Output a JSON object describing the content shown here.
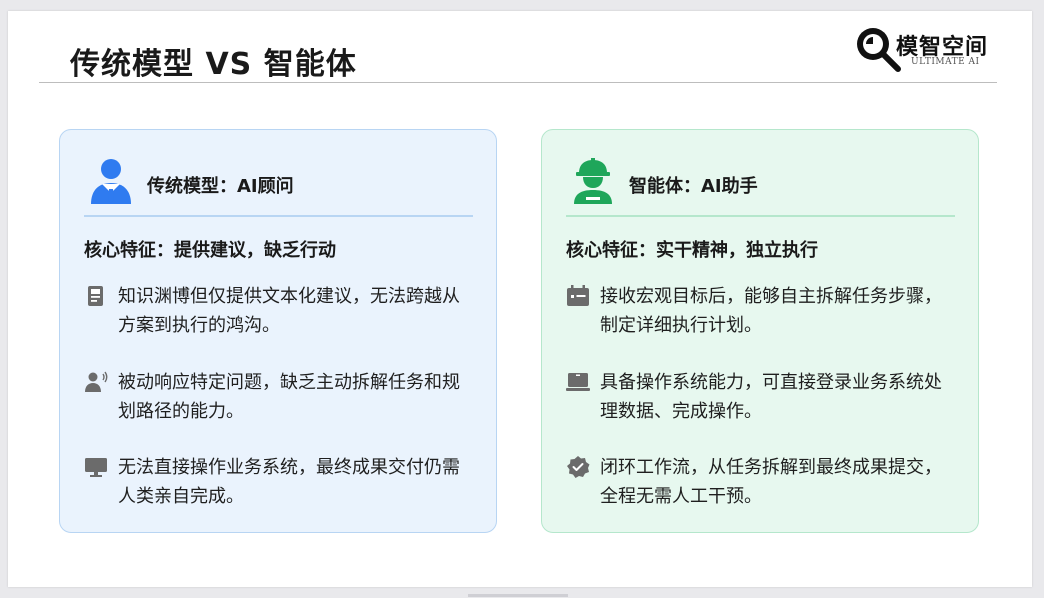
{
  "slide": {
    "title": "传统模型 VS 智能体",
    "logo": {
      "name": "模智空间",
      "sub": "ULTIMATE AI",
      "icon": "magnifier-logo-icon"
    }
  },
  "cards": [
    {
      "theme_color": "#3b82f6",
      "title": "传统模型：AI顾问",
      "header_icon": "advisor-person-icon",
      "subtitle": "核心特征：提供建议，缺乏行动",
      "items": [
        {
          "icon": "document-icon",
          "text": "知识渊博但仅提供文本化建议，无法跨越从方案到执行的鸿沟。"
        },
        {
          "icon": "person-speaking-icon",
          "text": "被动响应特定问题，缺乏主动拆解任务和规划路径的能力。"
        },
        {
          "icon": "monitor-icon",
          "text": "无法直接操作业务系统，最终成果交付仍需人类亲自完成。"
        }
      ]
    },
    {
      "theme_color": "#22a85a",
      "title": "智能体：AI助手",
      "header_icon": "worker-helmet-icon",
      "subtitle": "核心特征：实干精神，独立执行",
      "items": [
        {
          "icon": "calendar-icon",
          "text": "接收宏观目标后，能够自主拆解任务步骤，制定详细执行计划。"
        },
        {
          "icon": "laptop-icon",
          "text": "具备操作系统能力，可直接登录业务系统处理数据、完成操作。"
        },
        {
          "icon": "verified-badge-icon",
          "text": "闭环工作流，从任务拆解到最终成果提交，全程无需人工干预。"
        }
      ]
    }
  ]
}
